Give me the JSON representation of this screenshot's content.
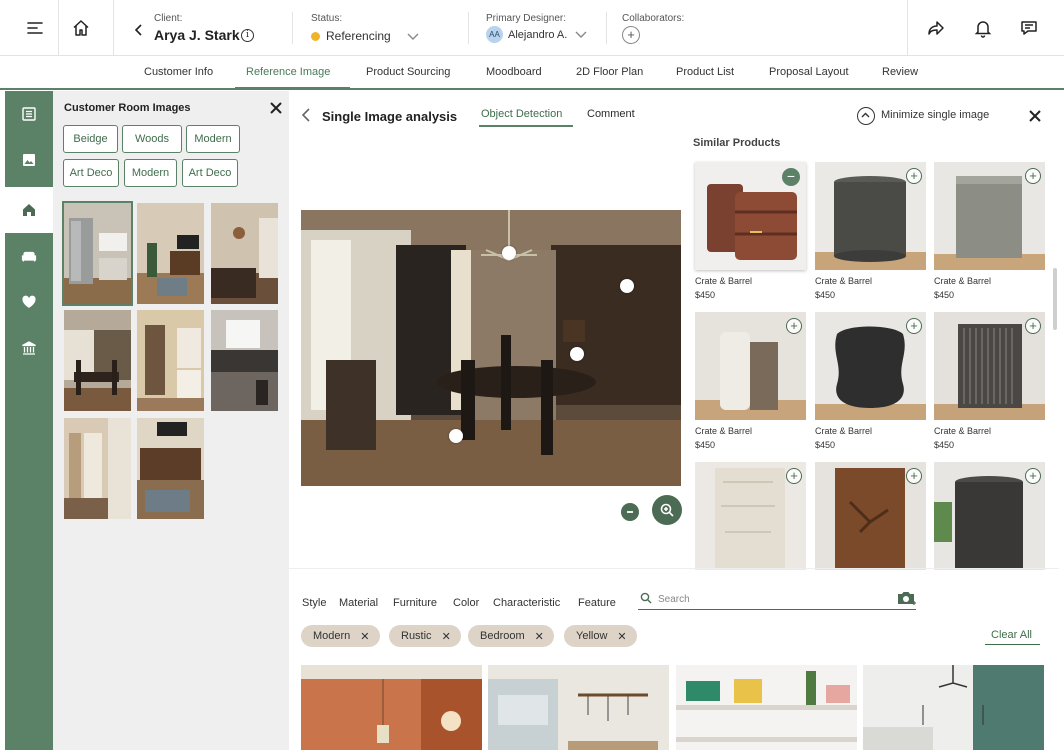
{
  "topbar": {
    "client_label": "Client:",
    "client_name": "Arya J. Stark",
    "status_label": "Status:",
    "status_value": "Referencing",
    "status_color": "#f0b429",
    "designer_label": "Primary Designer:",
    "designer_initials": "AA",
    "designer_name": "Alejandro A.",
    "collaborators_label": "Collaborators:",
    "collaborators_add": "+"
  },
  "tabs": [
    "Customer Info",
    "Reference Image",
    "Product Sourcing",
    "Moodboard",
    "2D Floor Plan",
    "Product List",
    "Proposal Layout",
    "Review"
  ],
  "active_tab": "Reference Image",
  "rail": [
    "list-icon",
    "image-icon",
    "home-icon",
    "sofa-icon",
    "heart-icon",
    "bank-icon"
  ],
  "customer_images": {
    "title": "Customer Room Images",
    "chips": [
      "Beidge",
      "Woods",
      "Modern",
      "Art Deco",
      "Modern",
      "Art Deco"
    ]
  },
  "analysis": {
    "title": "Single Image analysis",
    "tabs": [
      "Object Detection",
      "Comment"
    ],
    "minimize_label": "Minimize single image"
  },
  "similar": {
    "title": "Similar Products",
    "products": [
      {
        "brand": "Crate & Barrel",
        "price": "$450"
      },
      {
        "brand": "Crate & Barrel",
        "price": "$450"
      },
      {
        "brand": "Crate & Barrel",
        "price": "$450"
      },
      {
        "brand": "Crate & Barrel",
        "price": "$450"
      },
      {
        "brand": "Crate & Barrel",
        "price": "$450"
      },
      {
        "brand": "Crate & Barrel",
        "price": "$450"
      }
    ]
  },
  "filters": {
    "tabs": [
      "Style",
      "Material",
      "Furniture",
      "Color",
      "Characteristic",
      "Feature"
    ],
    "search_placeholder": "Search",
    "tags": [
      "Modern",
      "Rustic",
      "Bedroom",
      "Yellow"
    ],
    "clear_all": "Clear All"
  },
  "colors": {
    "accent": "#5b8266",
    "accent_dark": "#4c6b55",
    "tag_bg": "#ddd3c6"
  }
}
